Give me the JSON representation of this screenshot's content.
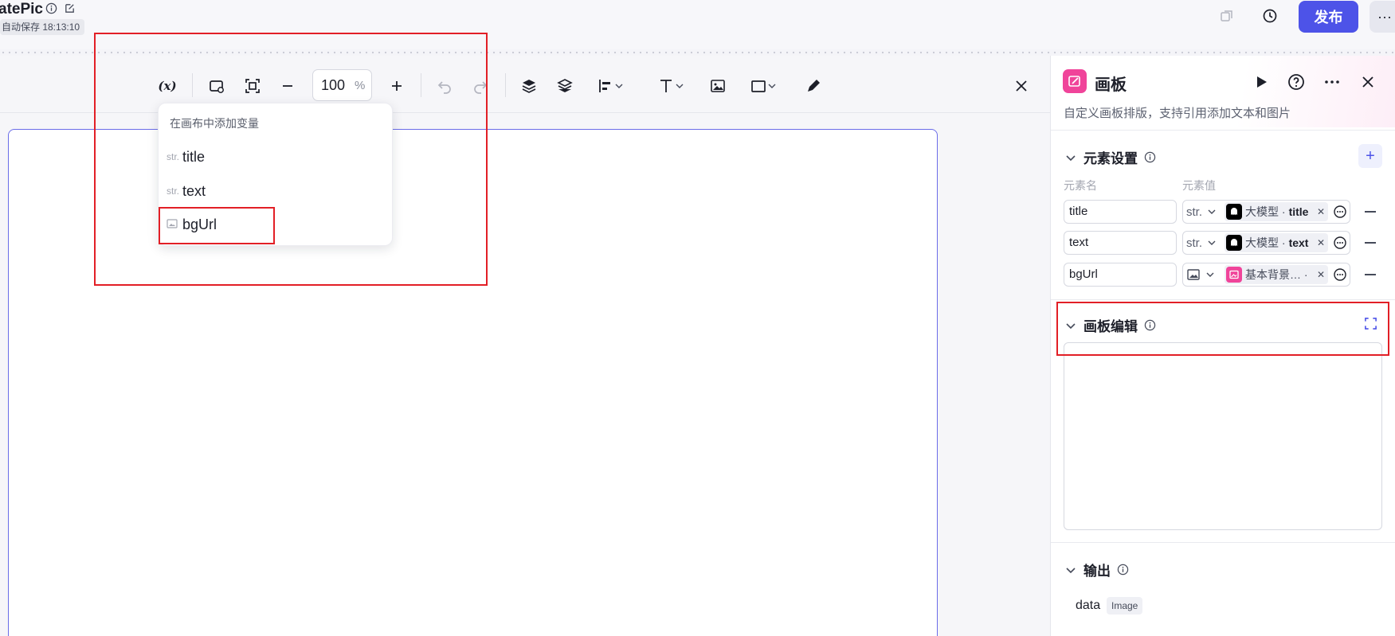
{
  "header": {
    "app_title": "atePic",
    "autosave": "自动保存 18:13:10",
    "publish_label": "发布",
    "more_label": "···"
  },
  "toolbar": {
    "var_label": "(x)",
    "zoom_value": "100",
    "zoom_unit": "%"
  },
  "variable_menu": {
    "title": "在画布中添加变量",
    "items": [
      {
        "type": "str.",
        "name": "title"
      },
      {
        "type": "str.",
        "name": "text"
      },
      {
        "type": "image",
        "name": "bgUrl"
      }
    ]
  },
  "panel": {
    "title": "画板",
    "description": "自定义画板排版，支持引用添加文本和图片",
    "elements_section": {
      "title": "元素设置",
      "col_name": "元素名",
      "col_value": "元素值",
      "add_label": "+",
      "rows": [
        {
          "name": "title",
          "type": "str.",
          "node": "大模型 ·",
          "field": "title"
        },
        {
          "name": "text",
          "type": "str.",
          "node": "大模型 ·",
          "field": "text"
        },
        {
          "name": "bgUrl",
          "type": "image",
          "node": "基本背景… ·",
          "field": ""
        }
      ]
    },
    "edit_section": {
      "title": "画板编辑"
    },
    "output_section": {
      "title": "输出",
      "var_name": "data",
      "var_type": "Image"
    }
  },
  "colors": {
    "accent": "#4d53e8",
    "highlight": "#e21f26",
    "brand_pink": "#f0449a"
  }
}
